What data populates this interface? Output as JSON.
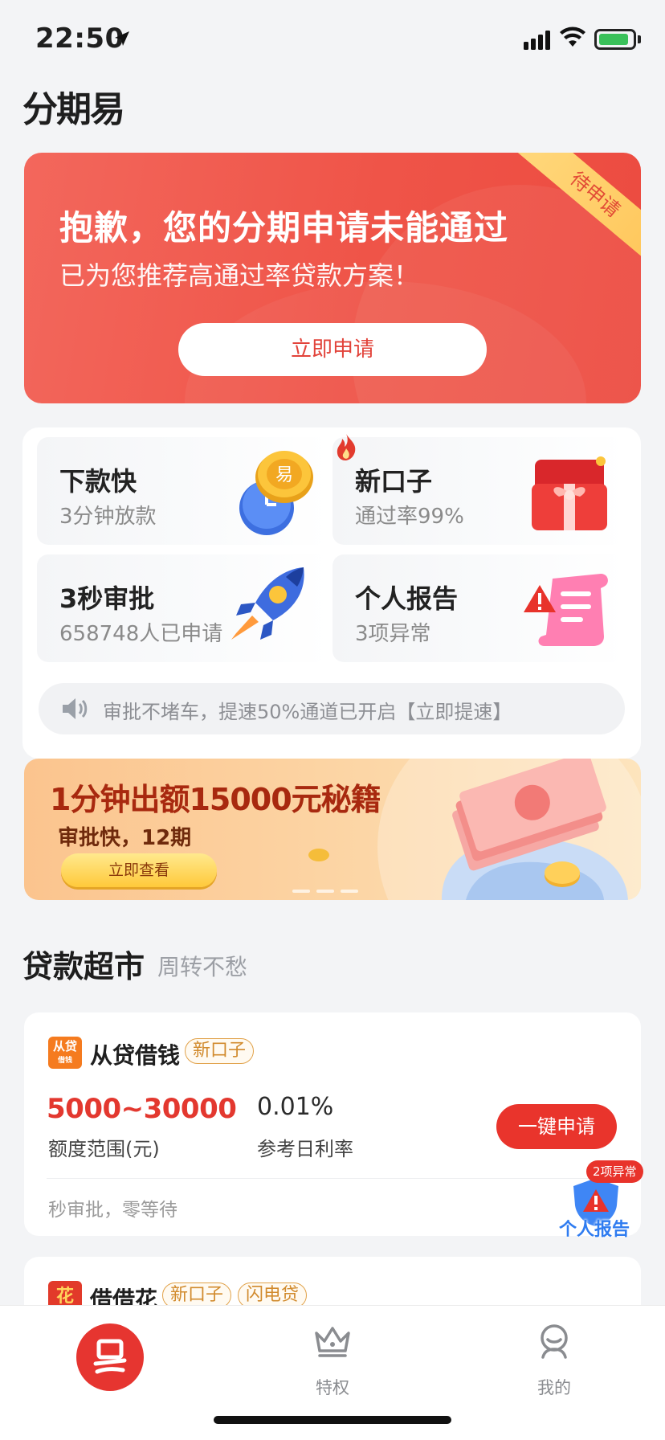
{
  "status_bar": {
    "time": "22:50"
  },
  "app": {
    "logo_text": "分期易"
  },
  "hero": {
    "ribbon": "待申请",
    "title": "抱歉，您的分期申请未能通过",
    "subtitle": "已为您推荐高通过率贷款方案！",
    "button": "立即申请"
  },
  "features": [
    {
      "title": "下款快",
      "subtitle": "3分钟放款",
      "icon": "gold-coin-clock-icon"
    },
    {
      "title": "新口子",
      "subtitle": "通过率99%",
      "icon": "red-envelope-icon"
    },
    {
      "title": "3秒审批",
      "subtitle": "658748人已申请",
      "icon": "rocket-icon"
    },
    {
      "title": "个人报告",
      "subtitle": "3项异常",
      "icon": "warning-report-icon"
    }
  ],
  "notice": {
    "text": "审批不堵车，提速50%通道已开启【立即提速】",
    "icon": "speaker-icon"
  },
  "promo": {
    "title": "1分钟出额15000元秘籍",
    "subtitle": "审批快，12期",
    "button": "立即查看"
  },
  "section": {
    "title": "贷款超市",
    "subtitle": "周转不愁"
  },
  "loans": [
    {
      "logo_text": "从贷",
      "logo_sub": "借钱",
      "name": "从贷借钱",
      "tags": [
        "新口子"
      ],
      "amount": "5000~30000",
      "amount_label": "额度范围(元)",
      "rate": "0.01%",
      "rate_label": "参考日利率",
      "button": "一键申请",
      "desc": "秒审批，零等待"
    },
    {
      "logo_text": "花",
      "name": "借借花",
      "tags": [
        "新口子",
        "闪电贷"
      ]
    }
  ],
  "float_report": {
    "badge": "2项异常",
    "label": "个人报告"
  },
  "tabs": [
    {
      "label": "",
      "icon": "home-logo-icon",
      "active": true
    },
    {
      "label": "特权",
      "icon": "crown-icon"
    },
    {
      "label": "我的",
      "icon": "profile-icon"
    }
  ],
  "colors": {
    "primary_red": "#e9342c",
    "tag_orange": "#d18a2c",
    "link_blue": "#2f7cf0"
  }
}
